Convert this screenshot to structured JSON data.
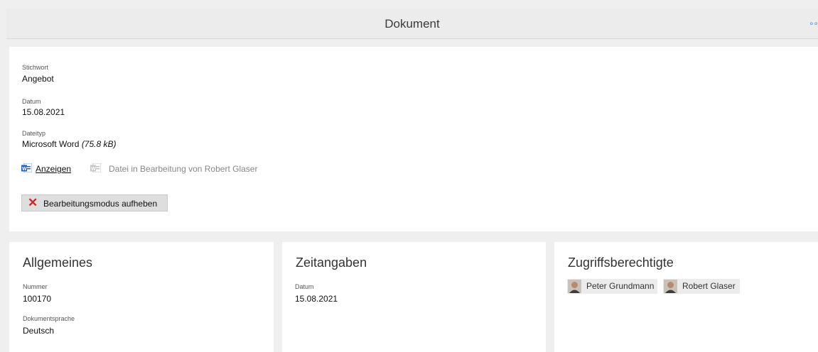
{
  "header": {
    "title": "Dokument",
    "more_label": "∘∘"
  },
  "main": {
    "stichwort_label": "Stichwort",
    "stichwort_value": "Angebot",
    "datum_label": "Datum",
    "datum_value": "15.08.2021",
    "dateityp_label": "Dateityp",
    "dateityp_value": "Microsoft Word",
    "dateityp_size": "(75.8 kB)",
    "show_link": "Anzeigen",
    "editing_note": "Datei in Bearbeitung von Robert Glaser",
    "release_button": "Bearbeitungsmodus aufheben"
  },
  "allgemeines": {
    "title": "Allgemeines",
    "nummer_label": "Nummer",
    "nummer_value": "100170",
    "sprache_label": "Dokumentsprache",
    "sprache_value": "Deutsch"
  },
  "zeitangaben": {
    "title": "Zeitangaben",
    "datum_label": "Datum",
    "datum_value": "15.08.2021"
  },
  "zugriff": {
    "title": "Zugriffsberechtigte",
    "users": [
      {
        "name": "Peter Grundmann"
      },
      {
        "name": "Robert Glaser"
      }
    ]
  },
  "colors": {
    "accent": "#3b86d6",
    "word_blue": "#2b62c4",
    "close_red": "#d42424"
  },
  "icons": [
    "word-document-icon",
    "word-document-locked-icon",
    "close-icon",
    "user-avatar-icon"
  ]
}
